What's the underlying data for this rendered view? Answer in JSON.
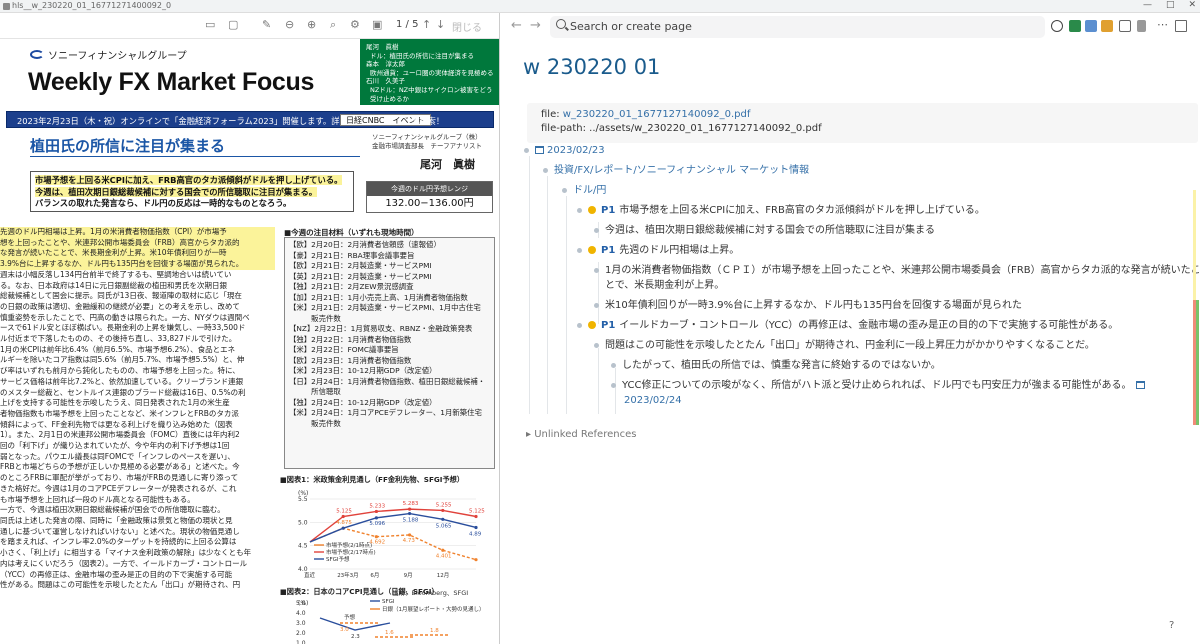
{
  "window": {
    "title": "hls__w_230220_01_16771271400092_0"
  },
  "pdf_toolbar": {
    "page": "1 / 5",
    "close": "閉じる"
  },
  "pdf": {
    "brand": "ソニーフィナンシャルグループ",
    "title": "Weekly FX Market Focus",
    "green_box": [
      "尾河　眞樹",
      "ドル：植田氏の所信に注目が集まる",
      "森本　淳太郎",
      "欧州通貨：ユーロ圏の実体経済を見極める",
      "石川　久美子",
      "NZドル：NZ中銀はサイクロン被害をどう受け止めるか"
    ],
    "banner": {
      "text": "2023年2月23日（木・祝）オンラインで「金融経済フォーラム2023」開催します。詳細は",
      "tag": "日経CNBC　イベント",
      "search": "で検索！"
    },
    "author_org": [
      "ソニーフィナンシャルグループ（株）",
      "金融市場調査部長　チーフアナリスト"
    ],
    "author_name": "尾河　眞樹",
    "headline": "植田氏の所信に注目が集まる",
    "summary": [
      "市場予想を上回る米CPIに加え、FRB高官のタカ派傾斜がドルを押し上げている。",
      "今週は、植田次期日銀総裁候補に対する国会での所信聴取に注目が集まる。",
      "バランスの取れた発言なら、ドル円の反応は一時的なものとなろう。"
    ],
    "range": {
      "label": "今週のドル円予想レンジ",
      "value": "132.00−136.00円"
    },
    "body": [
      "先週のドル円相場は上昇。1月の米消費者物価指数（CPI）が市場予",
      "想を上回ったことや、米連邦公開市場委員会（FRB）高官からタカ派的",
      "な発言が続いたことで、米長期金利が上昇。米10年債利回りが一時",
      "3.9%台に上昇するなか、ドル円も135円台を回復する場面が見られた。",
      "週末は小幅反落し134円台前半で終了するも、堅調地合いは続いてい",
      "る。なお、日本政府は14日に元日銀副総裁の植田和男氏を次期日銀",
      "総裁候補として国会に提示。同氏が13日夜、報道陣の取材に応じ「現在",
      "の日銀の政策は適切、金融緩和の継続が必要」との考えを示し、改めて",
      "慎重姿勢を示したことで、円高の動きは限られた。一方、NYダウは週間ベ",
      "ースで61ドル安とほぼ横ばい。長期金利の上昇を嫌気し、一時33,500ド",
      "ル付近まで下落したものの、その後持ち直し、33,827ドルで引けた。",
      "",
      "1月の米CPIは前年比6.4%（前月6.5%、市場予想6.2%）、食品とエネ",
      "ルギーを除いたコア指数は同5.6%（前月5.7%、市場予想5.5%）と、伸",
      "び率はいずれも前月から鈍化したものの、市場予想を上回った。特に、",
      "サービス価格は前年比7.2%と、依然加速している。クリーブランド連銀",
      "のメスター総裁と、セントルイス連銀のブラード総裁は16日、0.5%の利",
      "上げを支持する可能性を示唆したうえ、同日発表された1月の米生産",
      "者物価指数も市場予想を上回ったことなど、米インフレとFRBのタカ派",
      "傾斜によって、FF金利先物では更なる利上げを織り込み始めた（図表",
      "1）。また、2月1日の米連邦公開市場委員会（FOMC）直後には年内利2",
      "回の「利下げ」が織り込まれていたが、今や年内の利下げ予想は1回",
      "弱となった。パウエル議長は同FOMCで「インフレのペースを遅い」、",
      "FRBと市場どちらの予想が正しいか見極める必要がある」と述べた。今",
      "のところFRBに軍配が挙がっており、市場がFRBの見通しに寄り添って",
      "きた格好だ。今週は1月のコアPCEデフレーターが発表されるが、これ",
      "も市場予想を上回れば一段のドル高となる可能性もある。",
      "",
      "一方で、今週は植田次期日銀総裁候補が国会での所信聴取に臨む。",
      "同氏は上述した発言の際、同時に「金融政策は景気と物価の現状と見",
      "通しに基づいて運営しなければいけない」と述べた。現状の物価見通し",
      "を踏まえれば、インフレ率2.0%のターゲットを持続的に上回る公算は",
      "小さく、「利上げ」に相当する「マイナス金利政策の解除」は少なくとも年",
      "内は考えにくいだろう（図表2）。一方で、イールドカーブ・コントロール",
      "（YCC）の再修正は、金融市場の歪み是正の目的の下で実施する可能",
      "性がある。問題はこの可能性を示唆したとたん「出口」が期待され、円"
    ],
    "schedule_title": "■今週の注目材料（いずれも現地時間）",
    "schedule": [
      "【欧】2月20日：2月消費者信頼感（速報値）",
      "【豪】2月21日：RBA理事会議事要旨",
      "【欧】2月21日：2月製造業・サービスPMI",
      "【英】2月21日：2月製造業・サービスPMI",
      "【独】2月21日：2月ZEW景況感調査",
      "【加】2月21日：1月小売売上高、1月消費者物価指数",
      "【米】2月21日：2月製造業・サービスPMI、1月中古住宅",
      "　　　販売件数",
      "【NZ】2月22日：1月貿易収支、RBNZ・金融政策発表",
      "【独】2月22日：1月消費者物価指数",
      "【米】2月22日：FOMC議事要旨",
      "【欧】2月23日：1月消費者物価指数",
      "【米】2月23日：10-12月期GDP（改定値）",
      "【日】2月24日：1月消費者物価指数、植田日銀総裁候補・",
      "　　　所信聴取",
      "【独】2月24日：10-12月期GDP（改定値）",
      "【米】2月24日：1月コアPCEデフレーター、1月新築住宅",
      "　　　販売件数"
    ],
    "chart1_title": "■図表1：米政策金利見通し（FF金利先物、SFGI予想）",
    "chart1_source": "出所：Bloomberg、SFGI",
    "chart2_title": "■図表2：日本のコアCPI見通し（日銀、SFGI）"
  },
  "chart_data": [
    {
      "type": "line",
      "title": "■図表1：米政策金利見通し（FF金利先物、SFGI予想）",
      "ylabel": "(%)",
      "ylim": [
        4.0,
        5.5
      ],
      "categories": [
        "直近",
        "23年3月",
        "6月",
        "9月",
        "12月",
        ""
      ],
      "series": [
        {
          "name": "市場予想(2/1時点)",
          "values": [
            4.58,
            4.875,
            4.692,
            4.73,
            4.401,
            4.2
          ],
          "color": "#f0822d"
        },
        {
          "name": "市場予想(2/17時点)",
          "values": [
            4.58,
            5.125,
            5.233,
            5.283,
            5.255,
            5.125
          ],
          "color": "#e0423b"
        },
        {
          "name": "SFGI予想",
          "values": [
            4.58,
            4.875,
            5.096,
            5.188,
            5.065,
            4.89
          ],
          "color": "#2a4e9c"
        }
      ],
      "labels": [
        "4.875",
        "5.125",
        "5.233",
        "5.283",
        "5.255",
        "5.125",
        "5.096",
        "5.188",
        "5.065",
        "4.89",
        "4.692",
        "4.73",
        "4.401"
      ]
    },
    {
      "type": "line",
      "title": "■図表2：日本のコアCPI見通し（日銀、SFGI）",
      "ylabel": "(%)",
      "ylim": [
        1.0,
        5.0
      ],
      "series": [
        {
          "name": "SFGI",
          "values": [
            3.5,
            2.3,
            3.0
          ],
          "color": "#2a4e9c"
        },
        {
          "name": "日銀（1月展望レポート・大勢の見通し）",
          "values": [
            3.0,
            1.6,
            1.8
          ],
          "color": "#f0822d"
        }
      ],
      "labels": [
        "予想",
        "3.0",
        "1.6",
        "1.8",
        "2.3"
      ],
      "yticks": [
        "5.0",
        "4.0",
        "3.0",
        "2.0",
        "1.0"
      ]
    }
  ],
  "right": {
    "search_placeholder": "Search or create page",
    "page_title": "w 230220 01",
    "props": {
      "file_label": "file:",
      "file_value": "w_230220_01_1677127140092_0.pdf",
      "path_label": "file-path:",
      "path_value": "../assets/w_230220_01_1677127140092_0.pdf"
    },
    "date": "2023/02/23",
    "category": "投資/FX/レポート/ソニーフィナンシャル マーケット情報",
    "subcategory": "ドル/円",
    "blocks": [
      {
        "prio": "P1",
        "text": "市場予想を上回る米CPIに加え、FRB高官のタカ派傾斜がドルを押し上げている。"
      },
      {
        "text": "今週は、植田次期日銀総裁候補に対する国会での所信聴取に注目が集まる"
      },
      {
        "prio": "P1",
        "text": "先週のドル円相場は上昇。"
      },
      {
        "text": "1月の米消費者物価指数（ＣＰＩ）が市場予想を上回ったことや、米連邦公開市場委員会（FRB）高官からタカ派的な発言が続いたこ"
      },
      {
        "text": "とで、米長期金利が上昇。"
      },
      {
        "text": "米10年債利回りが一時3.9%台に上昇するなか、ドル円も135円台を回復する場面が見られた"
      },
      {
        "prio": "P1",
        "text": "イールドカーブ・コントロール（YCC）の再修正は、金融市場の歪み是正の目的の下で実施する可能性がある。"
      },
      {
        "text": "問題はこの可能性を示唆したとたん「出口」が期待され、円金利に一段上昇圧力がかかりやすくなることだ。"
      },
      {
        "text": "したがって、植田氏の所信では、慎重な発言に終始するのではないか。"
      },
      {
        "text": "YCC修正についての示唆がなく、所信がハト派と受け止められれば、ドル円でも円安圧力が強まる可能性がある。"
      },
      {
        "text": "2023/02/24"
      }
    ],
    "unlinked": "Unlinked References",
    "help": "?"
  }
}
